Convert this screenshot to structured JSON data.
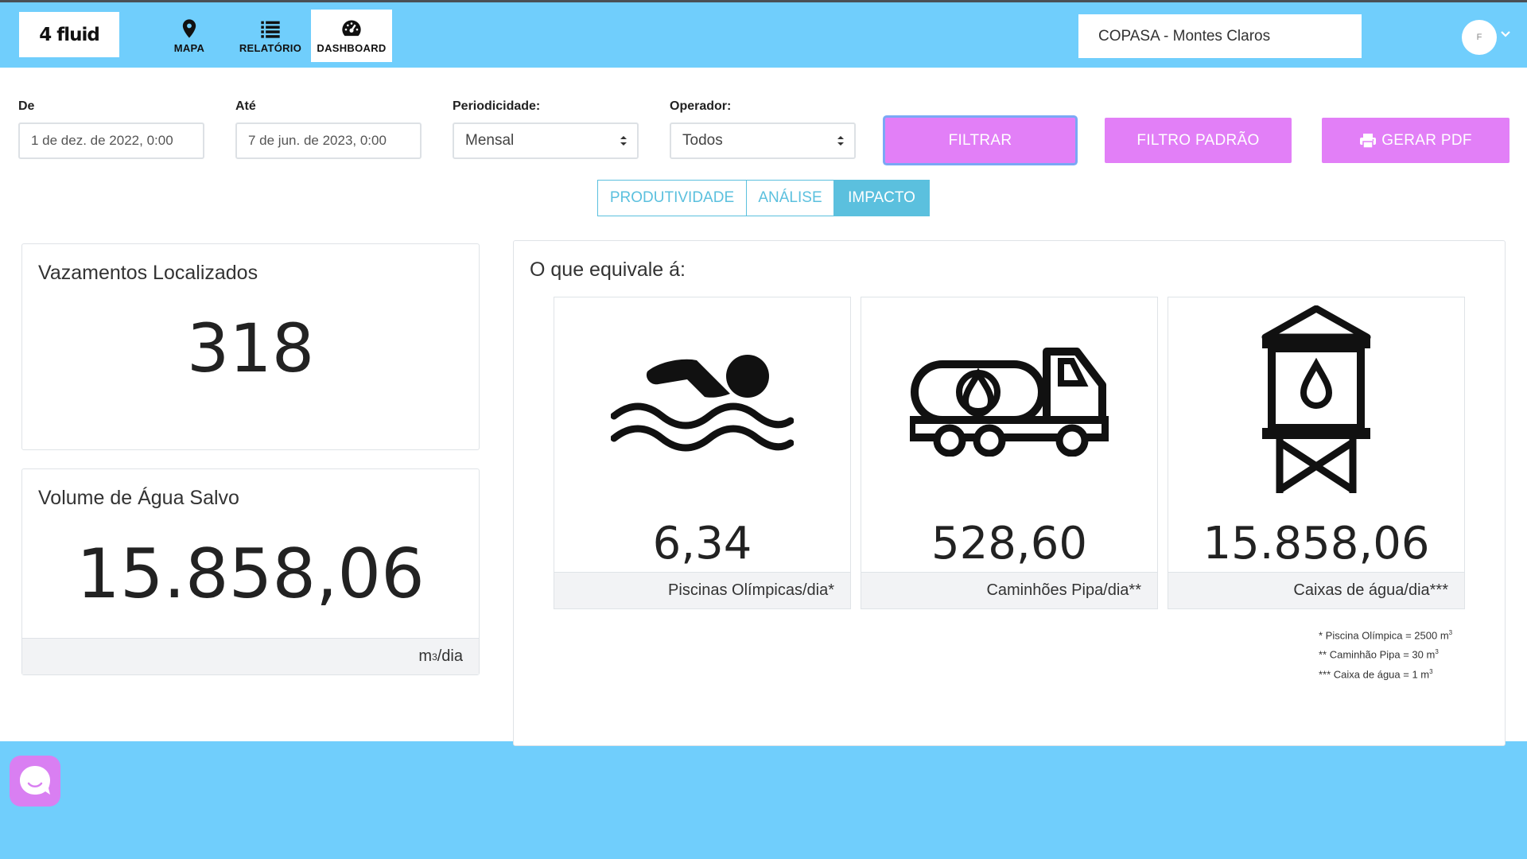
{
  "app": {
    "logo": "4 fluid"
  },
  "nav": [
    {
      "label": "MAPA",
      "icon": "map-pin-icon"
    },
    {
      "label": "RELATÓRIO",
      "icon": "list-icon"
    },
    {
      "label": "DASHBOARD",
      "icon": "dashboard-gauge-icon"
    }
  ],
  "company": "COPASA - Montes Claros",
  "user": {
    "initial": "F"
  },
  "filters": {
    "from_label": "De",
    "from_value": "1 de dez. de 2022, 0:00",
    "to_label": "Até",
    "to_value": "7 de jun. de 2023, 0:00",
    "period_label": "Periodicidade:",
    "period_value": "Mensal",
    "operator_label": "Operador:",
    "operator_value": "Todos"
  },
  "buttons": {
    "filter": "FILTRAR",
    "default_filter": "FILTRO PADRÃO",
    "pdf": "GERAR PDF"
  },
  "tabs": [
    {
      "label": "PRODUTIVIDADE",
      "active": false
    },
    {
      "label": "ANÁLISE",
      "active": false
    },
    {
      "label": "IMPACTO",
      "active": true
    }
  ],
  "leaks": {
    "title": "Vazamentos Localizados",
    "value": "318"
  },
  "volume": {
    "title": "Volume de Água Salvo",
    "value": "15.858,06",
    "unit_prefix": "m",
    "unit_sup": "3",
    "unit_suffix": "/dia"
  },
  "equivalence": {
    "title": "O que equivale á:",
    "items": [
      {
        "icon": "swimmer-icon",
        "value": "6,34",
        "label": "Piscinas Olímpicas/dia*"
      },
      {
        "icon": "water-truck-icon",
        "value": "528,60",
        "label": "Caminhões Pipa/dia**"
      },
      {
        "icon": "water-tower-icon",
        "value": "15.858,06",
        "label": "Caixas de água/dia***"
      }
    ],
    "notes": [
      {
        "text": "* Piscina Olímpica = 2500 m",
        "sup": "3"
      },
      {
        "text": "** Caminhão Pipa = 30 m",
        "sup": "3"
      },
      {
        "text": "*** Caixa de água = 1 m",
        "sup": "3"
      }
    ]
  },
  "colors": {
    "header": "#70cefc",
    "button": "#e27ff7",
    "tab": "#5bc0de"
  }
}
